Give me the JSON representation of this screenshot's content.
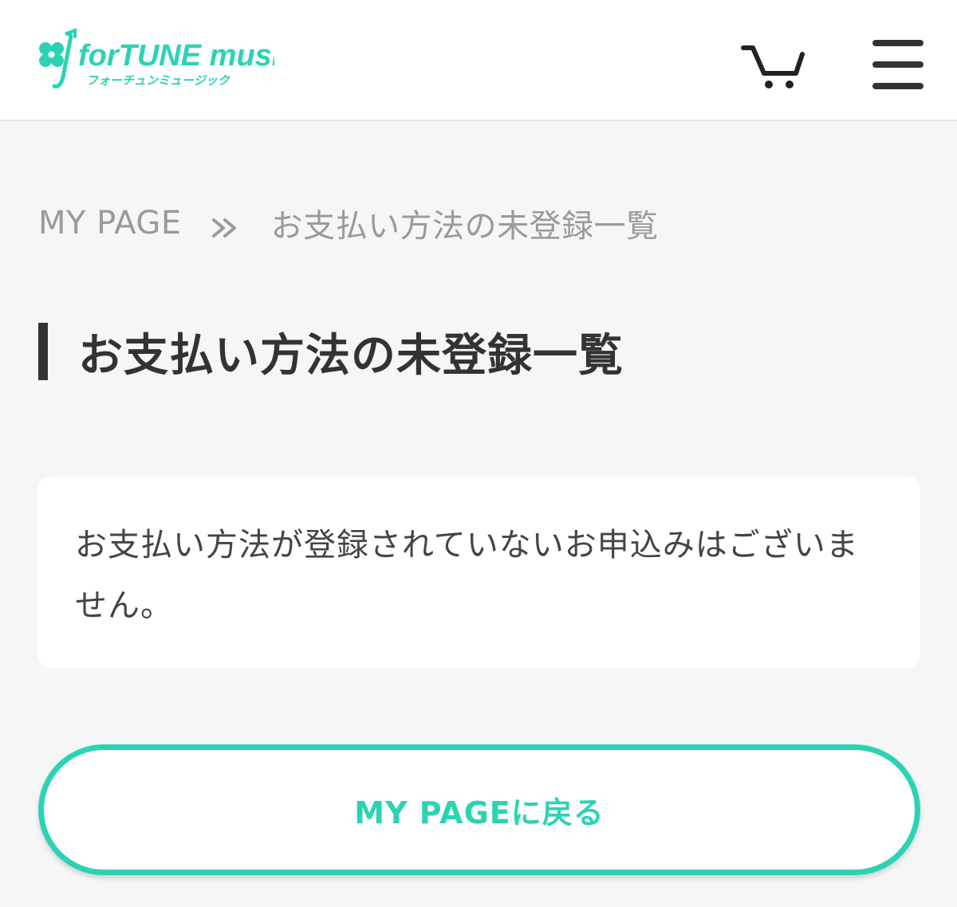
{
  "header": {
    "logo": {
      "wordmark": "forTUNE music",
      "subtitle": "フォーチュンミュージック",
      "brand_color": "#2bd3b4",
      "icon": "clover-note-icon"
    },
    "cart": {
      "icon": "cart-icon"
    },
    "menu": {
      "icon": "hamburger-menu-icon"
    }
  },
  "breadcrumb": {
    "home": "MY PAGE",
    "separator_icon": "double-chevron-right-icon",
    "current": "お支払い方法の未登録一覧"
  },
  "page": {
    "title": "お支払い方法の未登録一覧"
  },
  "notice": {
    "message": "お支払い方法が登録されていないお申込みはございません。"
  },
  "actions": {
    "back_label": "MY PAGEに戻る"
  },
  "colors": {
    "accent": "#2bd3b4",
    "text_dark": "#333333",
    "text_muted": "#9a9a9a",
    "background": "#f6f6f6"
  }
}
